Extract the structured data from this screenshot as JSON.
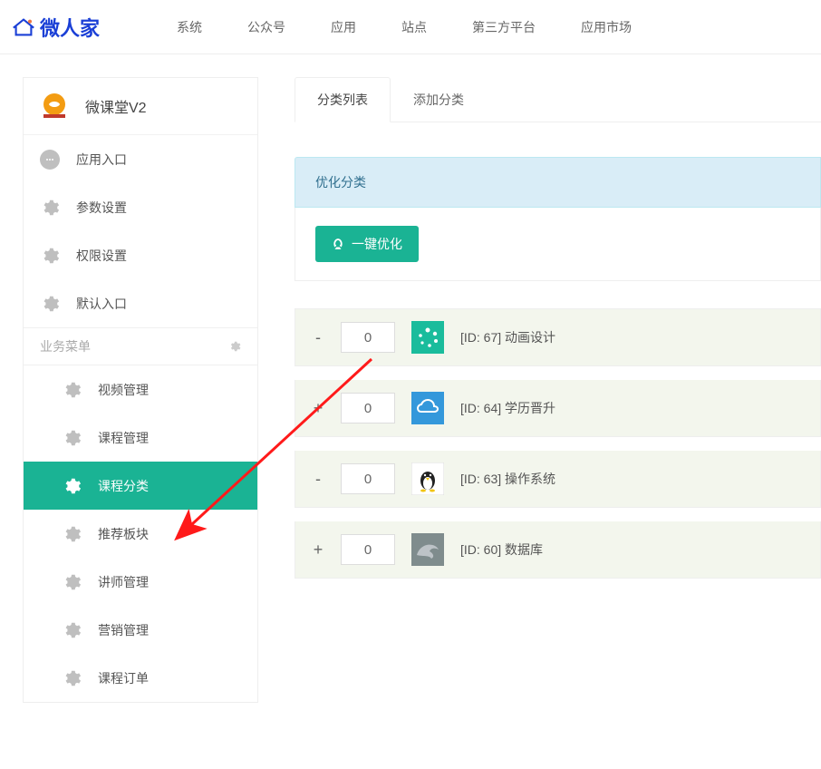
{
  "logo_text": "微人家",
  "topnav": [
    "系统",
    "公众号",
    "应用",
    "站点",
    "第三方平台",
    "应用市场"
  ],
  "app": {
    "title": "微课堂V2"
  },
  "system_menu": [
    {
      "label": "应用入口",
      "icon": "chat"
    },
    {
      "label": "参数设置",
      "icon": "gear"
    },
    {
      "label": "权限设置",
      "icon": "gear"
    },
    {
      "label": "默认入口",
      "icon": "gear"
    }
  ],
  "biz_section_title": "业务菜单",
  "biz_menu": [
    {
      "label": "视频管理",
      "active": false
    },
    {
      "label": "课程管理",
      "active": false
    },
    {
      "label": "课程分类",
      "active": true
    },
    {
      "label": "推荐板块",
      "active": false
    },
    {
      "label": "讲师管理",
      "active": false
    },
    {
      "label": "营销管理",
      "active": false
    },
    {
      "label": "课程订单",
      "active": false
    }
  ],
  "tabs": [
    {
      "label": "分类列表",
      "active": true
    },
    {
      "label": "添加分类",
      "active": false
    }
  ],
  "infobox_title": "优化分类",
  "optimize_button": "一键优化",
  "categories": [
    {
      "expander": "-",
      "sort": "0",
      "label": "[ID: 67] 动画设计",
      "icon": "teal-dots"
    },
    {
      "expander": "+",
      "sort": "0",
      "label": "[ID: 64] 学历晋升",
      "icon": "blue-cloud"
    },
    {
      "expander": "-",
      "sort": "0",
      "label": "[ID: 63] 操作系统",
      "icon": "penguin"
    },
    {
      "expander": "+",
      "sort": "0",
      "label": "[ID: 60] 数据库",
      "icon": "dolphin"
    }
  ]
}
